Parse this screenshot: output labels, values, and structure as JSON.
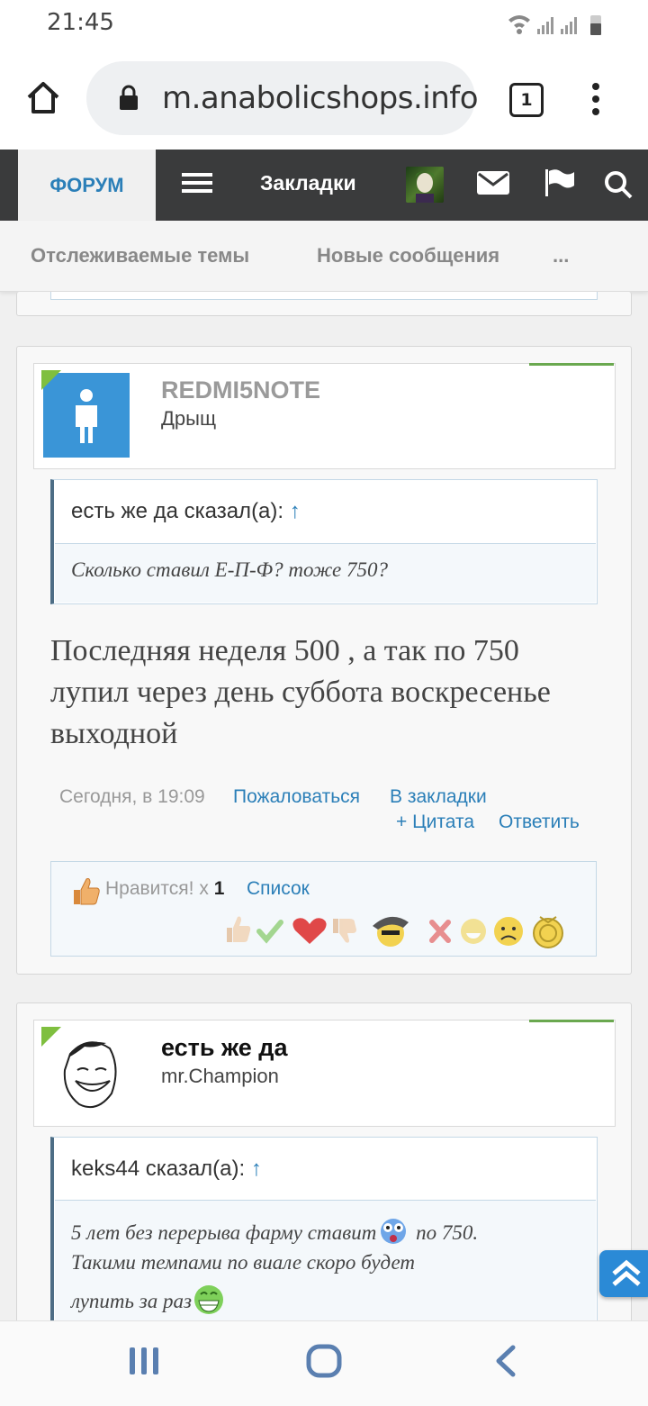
{
  "status": {
    "time": "21:45"
  },
  "browser": {
    "url": "m.anabolicshops.info",
    "tab_count": "1"
  },
  "nav": {
    "forum": "ФОРУМ",
    "bookmarks": "Закладки"
  },
  "subnav": {
    "watched": "Отслеживаемые темы",
    "new": "Новые сообщения",
    "more": "..."
  },
  "post1": {
    "username": "REDMI5NOTE",
    "title": "Дрыщ",
    "quote_head": "есть же да сказал(а):",
    "quote_arrow": "↑",
    "quote_text": "Сколько ставил Е-П-Ф? тоже 750?",
    "body": "Последняя неделя 500 , а так по 750 лупил через день суббота воскресенье выходной",
    "time": "Сегодня, в 19:09",
    "report": "Пожаловаться",
    "bookmark": "В закладки",
    "quote_action": "+ Цитата",
    "reply": "Ответить",
    "likes_label": "Нравится! x",
    "likes_count": "1",
    "likes_list": "Список"
  },
  "post2": {
    "username": "есть же да",
    "title": "mr.Champion",
    "quote_head": "keks44 сказал(а):",
    "quote_arrow": "↑",
    "quote_text_1": "5 лет без перерыва фарму ставит",
    "quote_text_2": "по 750.",
    "quote_text_3": "Такими темпами по виале скоро будет",
    "quote_text_4": "лупить за раз"
  },
  "colors": {
    "accent": "#2b7fb8",
    "nav_bg": "#3a3b3c",
    "green": "#6aa84f"
  }
}
